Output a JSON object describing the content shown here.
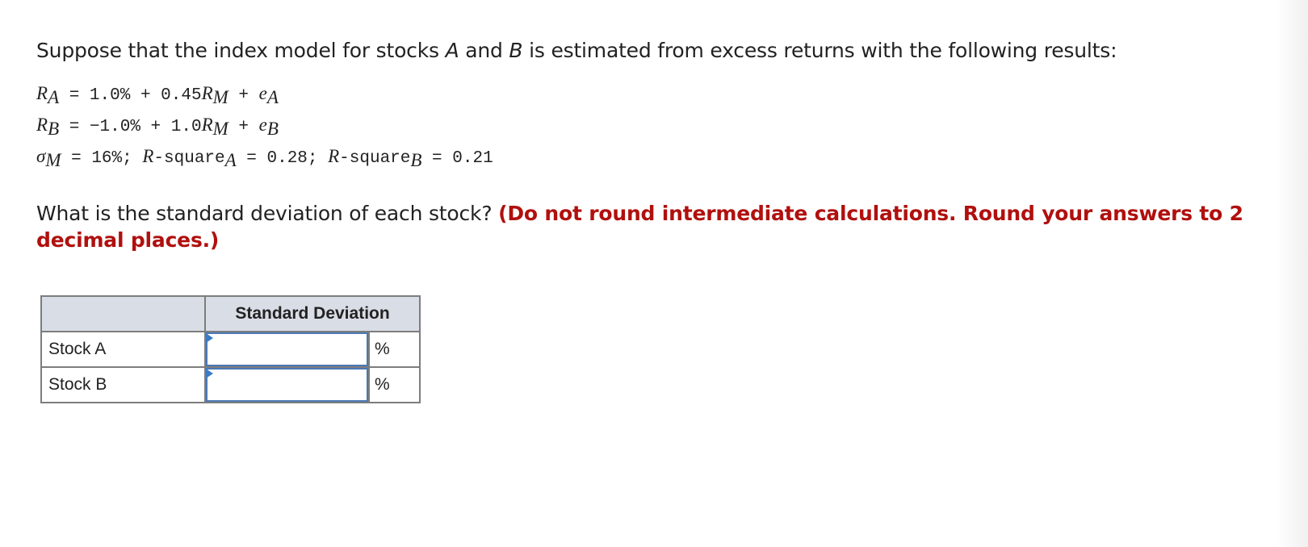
{
  "intro": {
    "pre": "Suppose that the index model for stocks ",
    "a": "A",
    "mid": " and ",
    "b": "B",
    "post": " is estimated from excess returns with the following results:"
  },
  "equations": [
    {
      "lhs": "R",
      "lhs_sub": "A",
      "rhs": " = 1.0% + 0.45",
      "r": "R",
      "r_sub": "M",
      "plus": " + ",
      "e": "e",
      "e_sub": "A"
    },
    {
      "lhs": "R",
      "lhs_sub": "B",
      "rhs": " = −1.0% + 1.0",
      "r": "R",
      "r_sub": "M",
      "plus": " + ",
      "e": "e",
      "e_sub": "B"
    }
  ],
  "sigma_line": {
    "sigma": "σ",
    "sigma_sub": "M",
    "t1": " = 16%; ",
    "r1": "R",
    "t2": "-square",
    "s1": "A",
    "t3": " = 0.28; ",
    "r2": "R",
    "t4": "-square",
    "s2": "B",
    "t5": " = 0.21"
  },
  "question": {
    "text": "What is the standard deviation of each stock? ",
    "instruction": "(Do not round intermediate calculations. Round your answers to 2 decimal places.)"
  },
  "table": {
    "header": "Standard Deviation",
    "rows": [
      {
        "label": "Stock A",
        "value": "",
        "unit": "%"
      },
      {
        "label": "Stock B",
        "value": "",
        "unit": "%"
      }
    ]
  },
  "colors": {
    "instruction": "#b0100e",
    "input_border": "#4a79b5",
    "header_bg": "#d9dde6"
  }
}
